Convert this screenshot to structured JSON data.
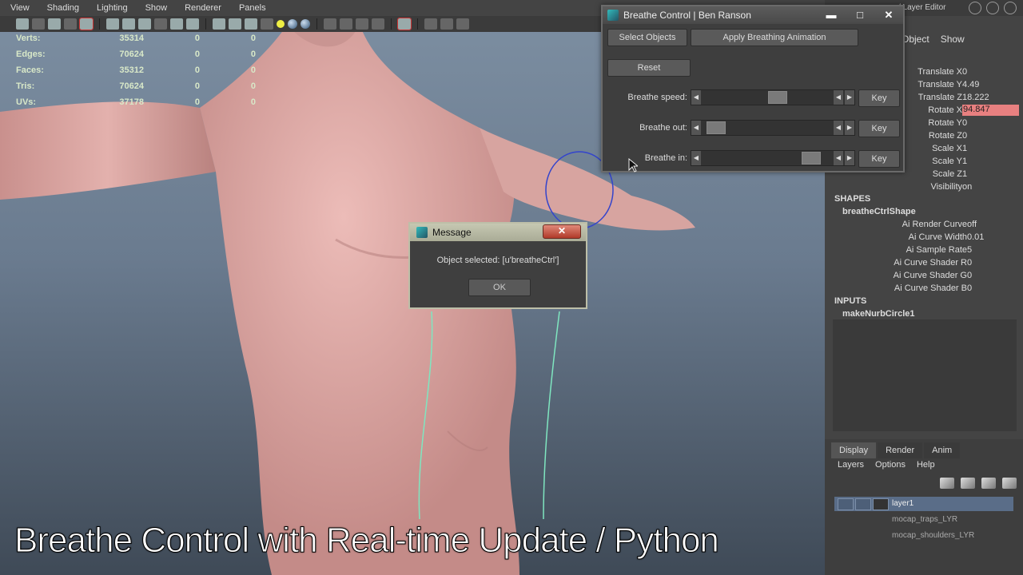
{
  "viewport": {
    "menu": [
      "View",
      "Shading",
      "Lighting",
      "Show",
      "Renderer",
      "Panels"
    ],
    "hud": [
      {
        "label": "Verts:",
        "v1": "35314",
        "v2": "0",
        "v3": "0"
      },
      {
        "label": "Edges:",
        "v1": "70624",
        "v2": "0",
        "v3": "0"
      },
      {
        "label": "Faces:",
        "v1": "35312",
        "v2": "0",
        "v3": "0"
      },
      {
        "label": "Tris:",
        "v1": "70624",
        "v2": "0",
        "v3": "0"
      },
      {
        "label": "UVs:",
        "v1": "37178",
        "v2": "0",
        "v3": "0"
      }
    ],
    "caption": "Breathe Control with Real-time Update / Python"
  },
  "breathe_window": {
    "title": "Breathe Control | Ben Ranson",
    "select_objects": "Select Objects",
    "apply_animation": "Apply Breathing Animation",
    "reset": "Reset",
    "speed_label": "Breathe speed:",
    "out_label": "Breathe out:",
    "in_label": "Breathe in:",
    "key_label": "Key",
    "speed_level": 0.6,
    "out_level": 0.05,
    "in_level": 0.9
  },
  "message_box": {
    "title": "Message",
    "close_glyph": "✕",
    "text": "Object selected: [u'breatheCtrl']",
    "ok": "OK"
  },
  "right_panel": {
    "top_title": "/ Layer Editor",
    "tabs": [
      "Object",
      "Show"
    ],
    "transform": [
      {
        "name": "Translate X",
        "value": "0"
      },
      {
        "name": "Translate Y",
        "value": "4.49"
      },
      {
        "name": "Translate Z",
        "value": "18.222"
      },
      {
        "name": "Rotate X",
        "value": "94.847"
      },
      {
        "name": "Rotate Y",
        "value": "0"
      },
      {
        "name": "Rotate Z",
        "value": "0"
      },
      {
        "name": "Scale X",
        "value": "1"
      },
      {
        "name": "Scale Y",
        "value": "1"
      },
      {
        "name": "Scale Z",
        "value": "1"
      },
      {
        "name": "Visibility",
        "value": "on"
      }
    ],
    "shapes_header": "SHAPES",
    "shape_node": "breatheCtrlShape",
    "shape_attrs": [
      {
        "name": "Ai Render Curve",
        "value": "off"
      },
      {
        "name": "Ai Curve Width",
        "value": "0.01"
      },
      {
        "name": "Ai Sample Rate",
        "value": "5"
      },
      {
        "name": "Ai Curve Shader R",
        "value": "0"
      },
      {
        "name": "Ai Curve Shader G",
        "value": "0"
      },
      {
        "name": "Ai Curve Shader B",
        "value": "0"
      }
    ],
    "inputs_header": "INPUTS",
    "input_node": "makeNurbCircle1",
    "layer_tabs": [
      "Display",
      "Render",
      "Anim"
    ],
    "layer_menu": [
      "Layers",
      "Options",
      "Help"
    ],
    "layers": [
      "layer1",
      "mocap_traps_LYR",
      "mocap_shoulders_LYR"
    ]
  },
  "colors": {
    "highlight_field": "#e88080",
    "layer_selected": "#5a6d88",
    "accent": "#3bb"
  }
}
